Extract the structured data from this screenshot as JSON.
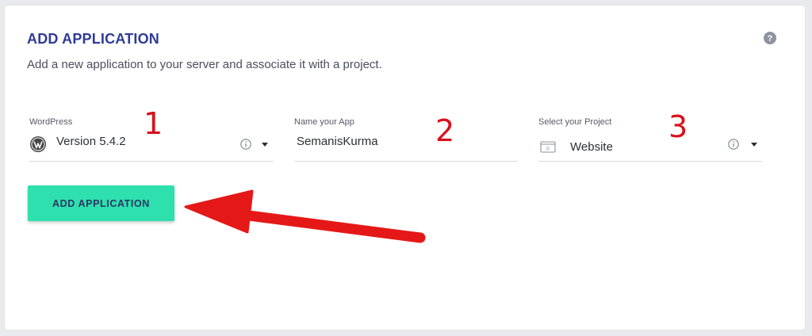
{
  "card": {
    "title": "ADD APPLICATION",
    "subtitle": "Add a new application to your server and associate it with a project."
  },
  "fields": {
    "wordpress": {
      "label": "WordPress",
      "value": "Version 5.4.2"
    },
    "app_name": {
      "label": "Name your App",
      "value": "SemanisKurma"
    },
    "project": {
      "label": "Select your Project",
      "value": "Website"
    }
  },
  "annotations": [
    "1",
    "2",
    "3"
  ],
  "button": {
    "label": "ADD APPLICATION"
  },
  "colors": {
    "title": "#2f3b98",
    "button_bg": "#2ee0ad",
    "button_text": "#2b3566",
    "annotation": "#d8101a"
  },
  "icons": {
    "help": "question-circle-icon",
    "wordpress": "wordpress-logo-icon",
    "info": "info-circle-icon",
    "dropdown": "caret-down-icon",
    "project": "project-folder-icon"
  }
}
